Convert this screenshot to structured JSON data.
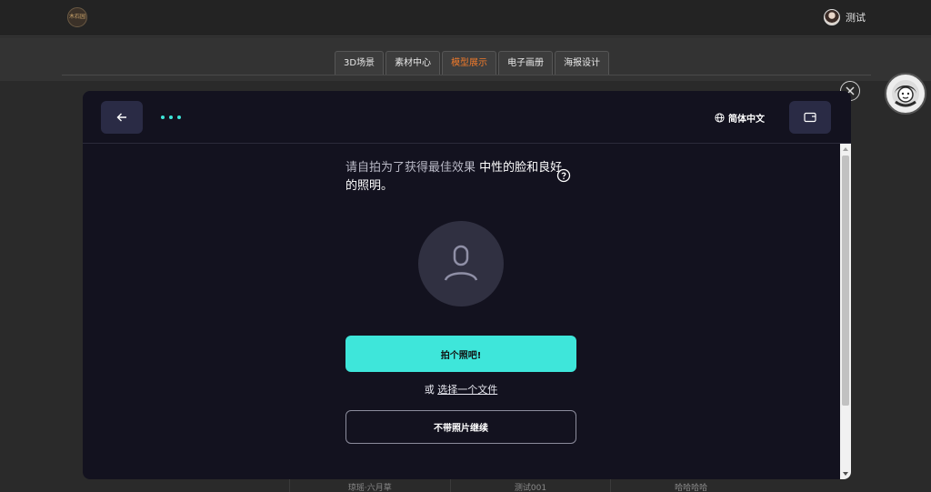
{
  "header": {
    "logo_text": "木石园",
    "user_name": "测试"
  },
  "tabs": [
    {
      "label": "3D场景",
      "active": false
    },
    {
      "label": "素材中心",
      "active": false
    },
    {
      "label": "模型展示",
      "active": true
    },
    {
      "label": "电子画册",
      "active": false
    },
    {
      "label": "海报设计",
      "active": false
    }
  ],
  "background_row": [
    "琼瑶·六月草",
    "测试001",
    "哈哈哈哈"
  ],
  "modal": {
    "language_label": "简体中文",
    "instruction_muted": "请自拍为了获得最佳效果",
    "instruction_main": " 中性的脸和良好的照明。",
    "primary_button": "拍个照吧!",
    "or_text": "或 ",
    "choose_file_link": "选择一个文件",
    "secondary_button": "不带照片继续"
  },
  "colors": {
    "accent": "#3ee6da",
    "active_tab": "#f07a2b",
    "modal_bg": "#13121f"
  },
  "icons": {
    "back": "arrow-left-icon",
    "more": "more-dots-icon",
    "language": "globe-icon",
    "wallet": "wallet-icon",
    "help": "question-icon",
    "face": "user-icon",
    "close": "close-icon"
  }
}
